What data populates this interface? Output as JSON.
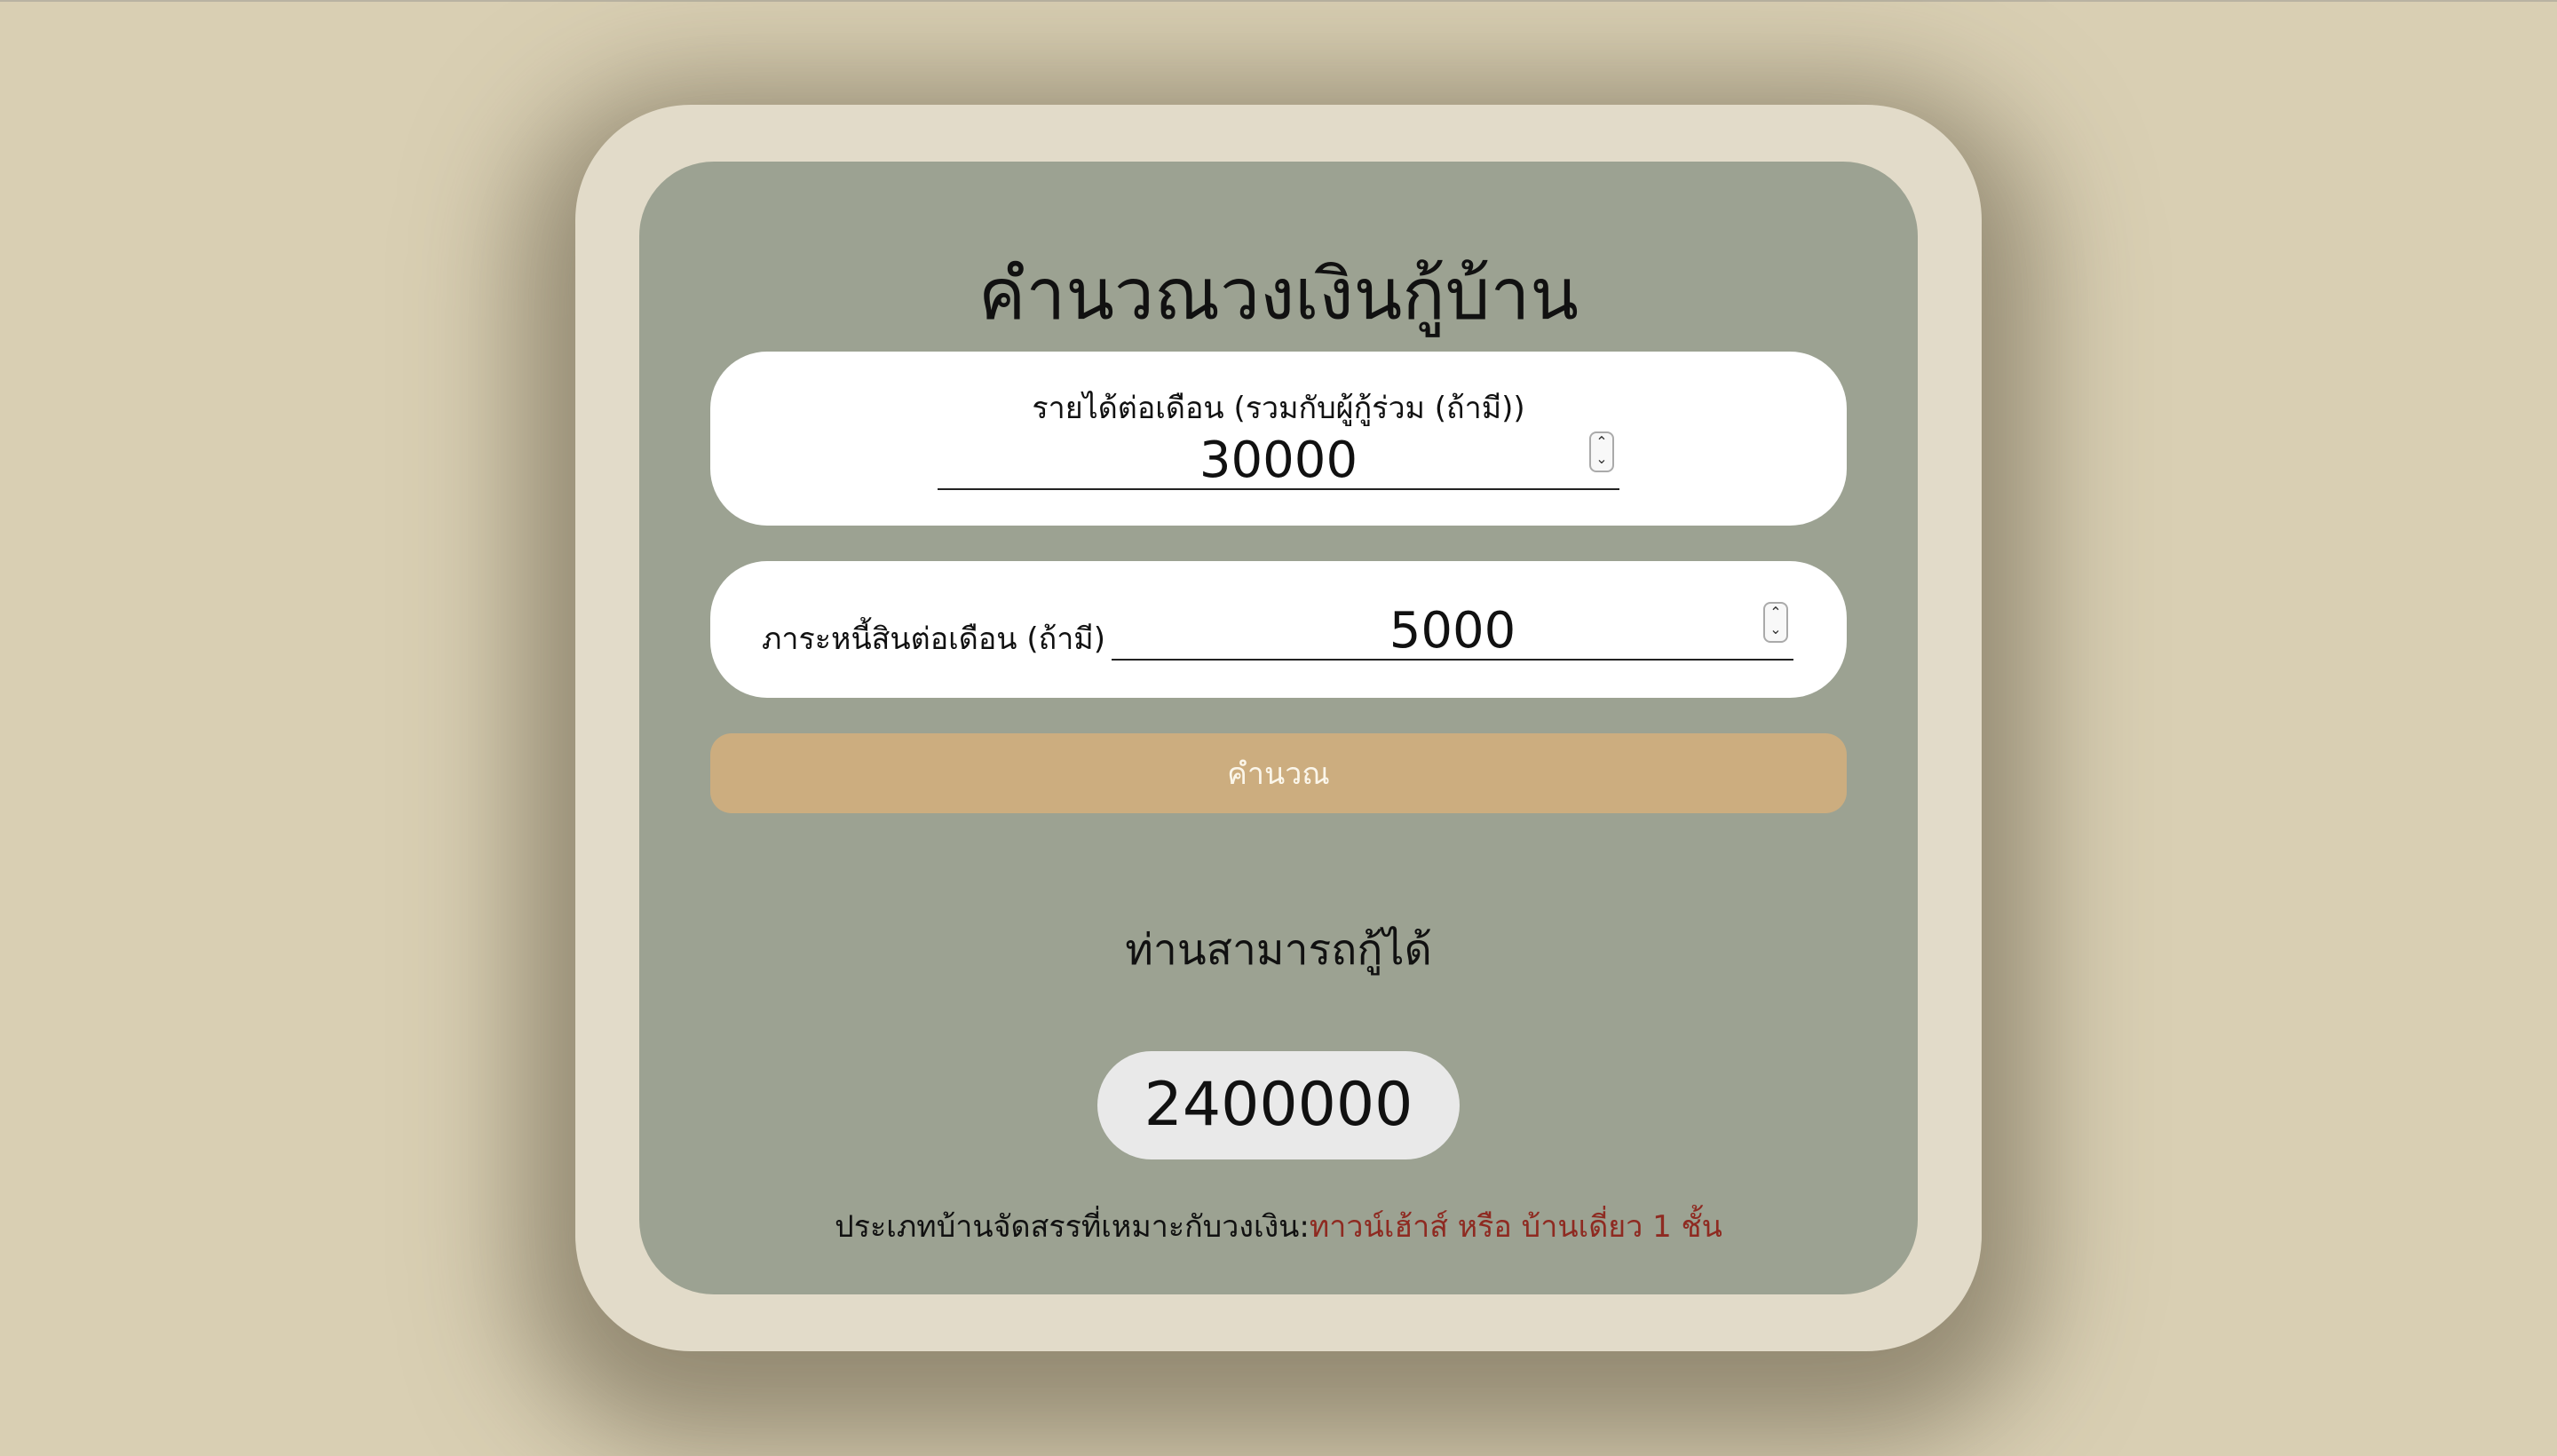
{
  "title": "คำนวณวงเงินกู้บ้าน",
  "income_field": {
    "label": "รายได้ต่อเดือน (รวมกับผู้กู้ร่วม (ถ้ามี))",
    "value": "30000"
  },
  "debt_field": {
    "label": "ภาระหนี้สินต่อเดือน (ถ้ามี)",
    "value": "5000"
  },
  "calculate_button": "คำนวณ",
  "result": {
    "heading": "ท่านสามารถกู้ได้",
    "amount": "2400000",
    "house_type_label": "ประเภทบ้านจัดสรรที่เหมาะกับวงเงิน:",
    "house_type_value": "ทาวน์เฮ้าส์ หรือ บ้านเดี่ยว 1 ชั้น"
  },
  "colors": {
    "background": "#d9cfb3",
    "outer_card": "#e2dbc9",
    "inner_card": "#9ca292",
    "button": "#ccad7f",
    "house_type_value": "#8e2a21"
  }
}
